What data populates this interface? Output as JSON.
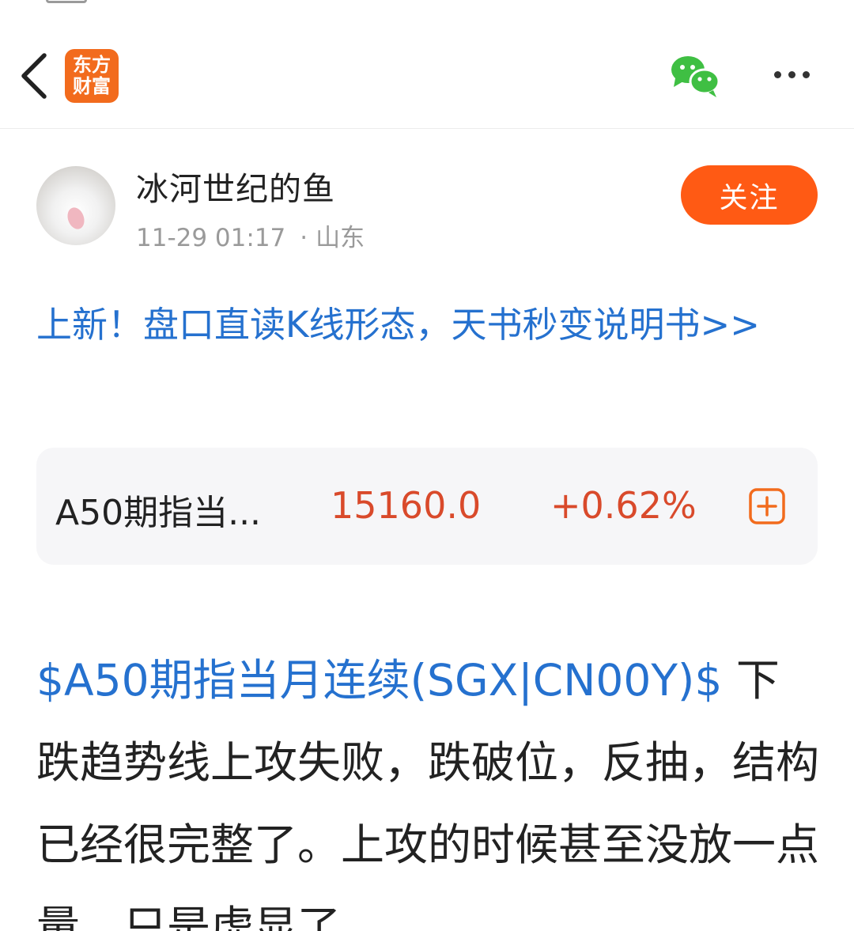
{
  "header": {
    "logo_line1": "东方",
    "logo_line2": "财富",
    "logo_color": "#f26b1d",
    "back_icon": "chevron-left-icon",
    "share_icon": "wechat-icon",
    "more_icon": "more-dots-icon"
  },
  "author": {
    "name": "冰河世纪的鱼",
    "datetime": "11-29 01:17",
    "separator": "·",
    "location": "山东",
    "follow_label": "关注",
    "follow_color": "#ff5a14"
  },
  "promo": {
    "text": "上新！盘口直读K线形态，天书秒变说明书>>",
    "color": "#2571cf"
  },
  "stock": {
    "name": "A50期指当...",
    "price": "15160.0",
    "change": "+0.62%",
    "change_color": "#d94a2b",
    "add_icon": "plus-square-icon"
  },
  "post": {
    "stock_tag": "$A50期指当月连续(SGX|CN00Y)$",
    "text": " 下跌趋势线上攻失败，跌破位，反抽，结构已经很完整了。上攻的时候甚至没放一点量，只是虚显了"
  }
}
